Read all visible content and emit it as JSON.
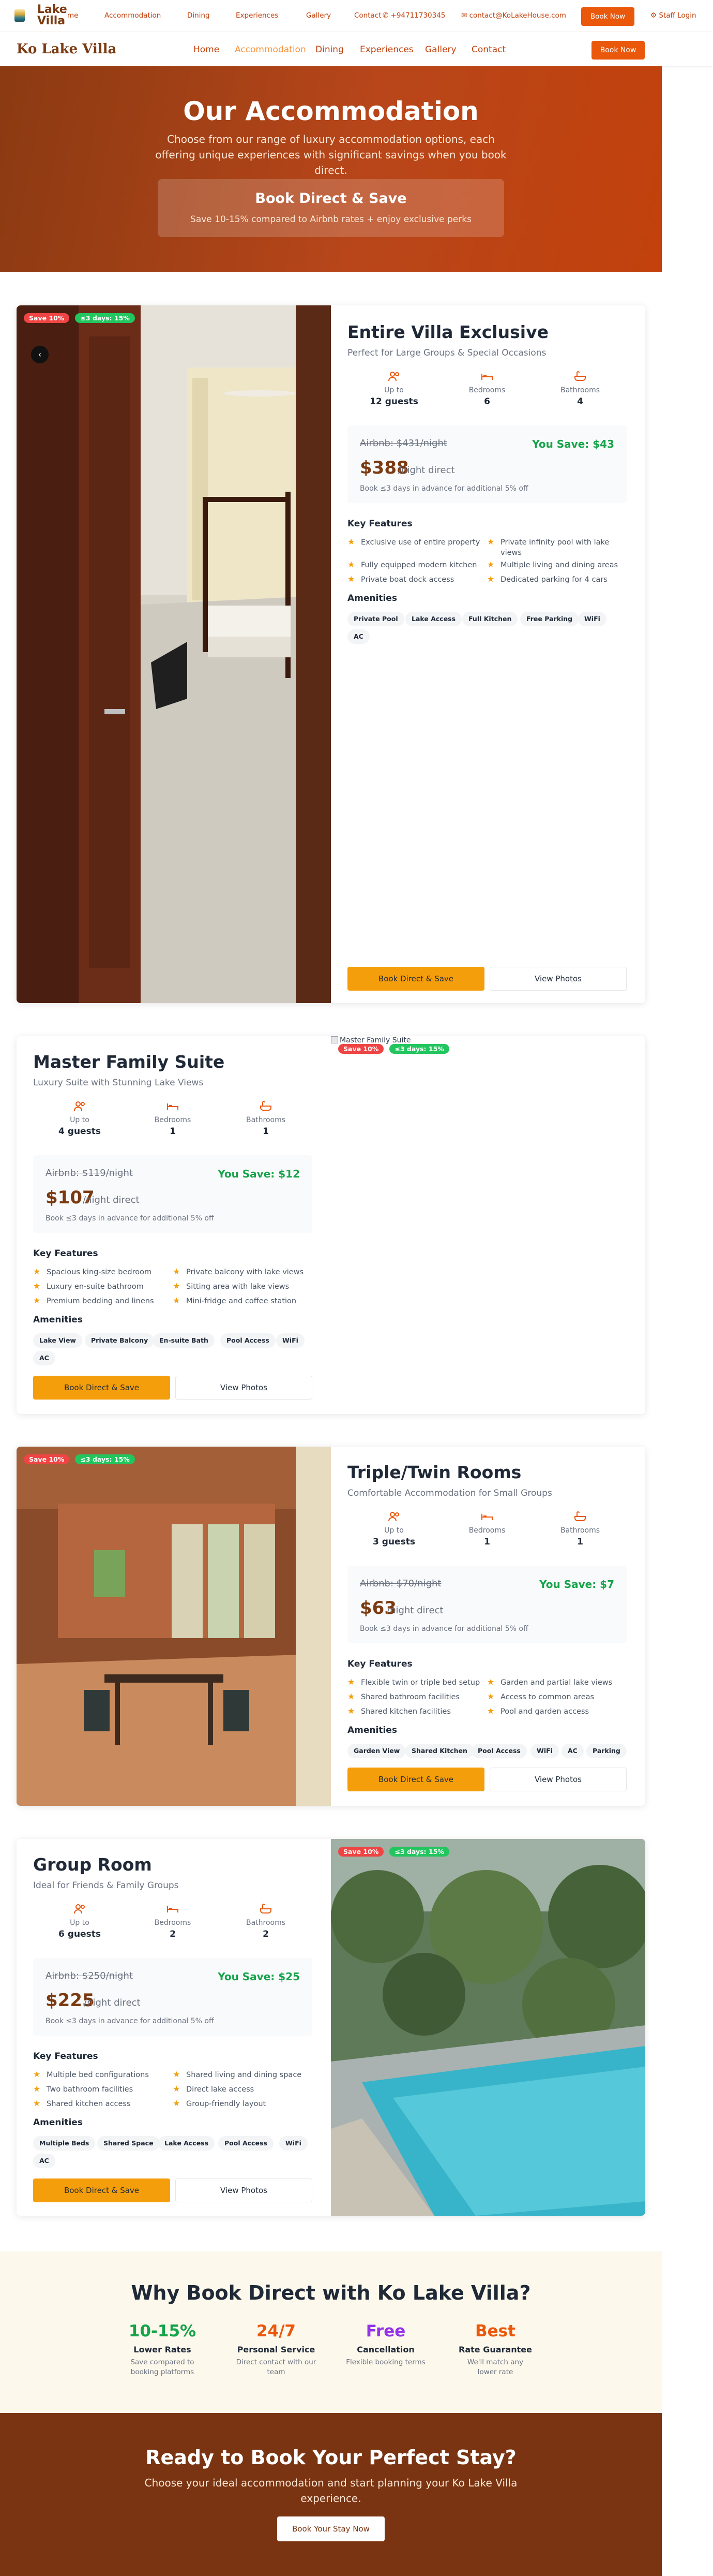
{
  "topbar": {
    "logo_text": "Lake Villa",
    "links": [
      "me",
      "Accommodation",
      "Dining",
      "Experiences",
      "Gallery",
      "Contact"
    ],
    "phone": "+94711730345",
    "email": "contact@KoLakeHouse.com",
    "book_now": "Book Now",
    "staff_login": "Staff Login"
  },
  "nav": {
    "brand": "Ko Lake Villa",
    "links": [
      "Home",
      "Accommodation",
      "Dining",
      "Experiences",
      "Gallery",
      "Contact"
    ],
    "active": "Accommodation",
    "book_now": "Book Now"
  },
  "hero": {
    "title": "Our Accommodation",
    "subtitle": "Choose from our range of luxury accommodation options, each offering unique experiences with significant savings when you book direct.",
    "box_title": "Book Direct & Save",
    "box_text": "Save 10-15% compared to Airbnb rates + enjoy exclusive perks"
  },
  "labels": {
    "up_to": "Up to",
    "bedrooms": "Bedrooms",
    "bathrooms": "Bathrooms",
    "key_features": "Key Features",
    "amenities": "Amenities",
    "book_direct": "Book Direct & Save",
    "view_photos": "View Photos",
    "per_night": "/night direct",
    "advance_note": "Book ≤3 days in advance for additional 5% off"
  },
  "rooms": [
    {
      "name": "Entire Villa Exclusive",
      "subtitle": "Perfect for Large Groups & Special Occasions",
      "badges": [
        "Save 10%",
        "≤3 days: 15%"
      ],
      "guests": "12 guests",
      "bedrooms": "6",
      "bathrooms": "4",
      "orig_price": "Airbnb: $431/night",
      "save": "You Save: $43",
      "price": "$388",
      "features": [
        "Exclusive use of entire property",
        "Private infinity pool with lake views",
        "Fully equipped modern kitchen",
        "Multiple living and dining areas",
        "Private boat dock access",
        "Dedicated parking for 4 cars"
      ],
      "amenities": [
        "Private Pool",
        "Lake Access",
        "Full Kitchen",
        "Free Parking",
        "WiFi",
        "AC"
      ]
    },
    {
      "name": "Master Family Suite",
      "subtitle": "Luxury Suite with Stunning Lake Views",
      "badges": [
        "Save 10%",
        "≤3 days: 15%"
      ],
      "image_alt": "Master Family Suite",
      "guests": "4 guests",
      "bedrooms": "1",
      "bathrooms": "1",
      "orig_price": "Airbnb: $119/night",
      "save": "You Save: $12",
      "price": "$107",
      "features": [
        "Spacious king-size bedroom",
        "Private balcony with lake views",
        "Luxury en-suite bathroom",
        "Sitting area with lake views",
        "Premium bedding and linens",
        "Mini-fridge and coffee station"
      ],
      "amenities": [
        "Lake View",
        "Private Balcony",
        "En-suite Bath",
        "Pool Access",
        "WiFi",
        "AC"
      ]
    },
    {
      "name": "Triple/Twin Rooms",
      "subtitle": "Comfortable Accommodation for Small Groups",
      "badges": [
        "Save 10%",
        "≤3 days: 15%"
      ],
      "guests": "3 guests",
      "bedrooms": "1",
      "bathrooms": "1",
      "orig_price": "Airbnb: $70/night",
      "save": "You Save: $7",
      "price": "$63",
      "features": [
        "Flexible twin or triple bed setup",
        "Garden and partial lake views",
        "Shared bathroom facilities",
        "Access to common areas",
        "Shared kitchen facilities",
        "Pool and garden access"
      ],
      "amenities": [
        "Garden View",
        "Shared Kitchen",
        "Pool Access",
        "WiFi",
        "AC",
        "Parking"
      ]
    },
    {
      "name": "Group Room",
      "subtitle": "Ideal for Friends & Family Groups",
      "badges": [
        "Save 10%",
        "≤3 days: 15%"
      ],
      "guests": "6 guests",
      "bedrooms": "2",
      "bathrooms": "2",
      "orig_price": "Airbnb: $250/night",
      "save": "You Save: $25",
      "price": "$225",
      "features": [
        "Multiple bed configurations",
        "Shared living and dining space",
        "Two bathroom facilities",
        "Direct lake access",
        "Shared kitchen access",
        "Group-friendly layout"
      ],
      "amenities": [
        "Multiple Beds",
        "Shared Space",
        "Lake Access",
        "Pool Access",
        "WiFi",
        "AC"
      ]
    }
  ],
  "why": {
    "title": "Why Book Direct with Ko Lake Villa?",
    "items": [
      {
        "big": "10-15%",
        "label": "Lower Rates",
        "text": "Save compared to booking platforms",
        "color": "#16a34a"
      },
      {
        "big": "24/7",
        "label": "Personal Service",
        "text": "Direct contact with our team",
        "color": "#ea580c"
      },
      {
        "big": "Free",
        "label": "Cancellation",
        "text": "Flexible booking terms",
        "color": "#9333ea"
      },
      {
        "big": "Best",
        "label": "Rate Guarantee",
        "text": "We'll match any lower rate",
        "color": "#ea580c"
      }
    ]
  },
  "cta": {
    "title": "Ready to Book Your Perfect Stay?",
    "text": "Choose your ideal accommodation and start planning your Ko Lake Villa experience.",
    "button": "Book Your Stay Now"
  },
  "colors": {
    "brand": "#7a3a12",
    "accent": "#ea580c",
    "amber": "#f59e0b",
    "save_green": "#16a34a"
  }
}
